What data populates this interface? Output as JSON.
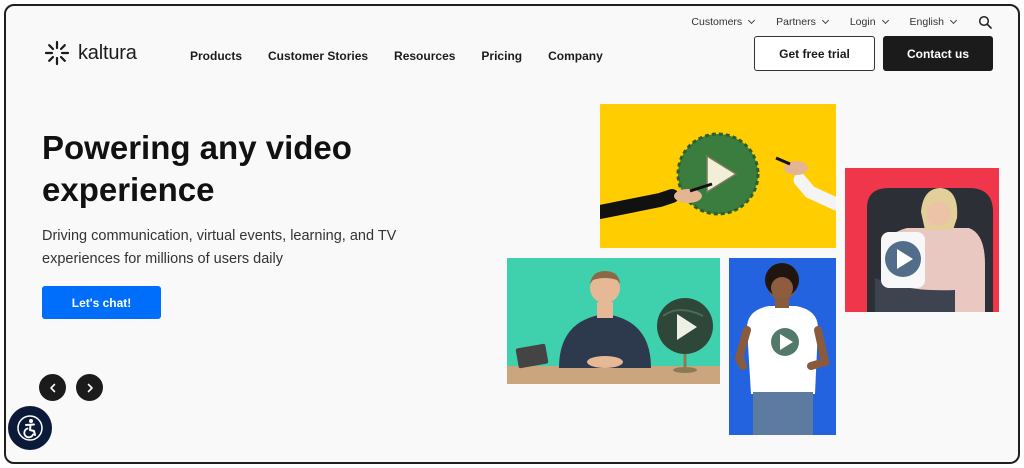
{
  "utility_nav": {
    "customers": "Customers",
    "partners": "Partners",
    "login": "Login",
    "language": "English"
  },
  "brand": {
    "logo_text": "kaltura"
  },
  "main_nav": {
    "products": "Products",
    "customer_stories": "Customer Stories",
    "resources": "Resources",
    "pricing": "Pricing",
    "company": "Company"
  },
  "header_actions": {
    "trial": "Get free trial",
    "contact": "Contact us"
  },
  "hero": {
    "title": "Powering any video experience",
    "subtitle": "Driving communication, virtual events, learning, and TV experiences for millions of users daily",
    "cta": "Let's chat!"
  },
  "colors": {
    "accent": "#006efa",
    "dark": "#1b1b1b",
    "tile_yellow": "#ffcd00",
    "tile_red": "#f0364b",
    "tile_green": "#3fd0ae",
    "tile_blue": "#2463e0"
  }
}
